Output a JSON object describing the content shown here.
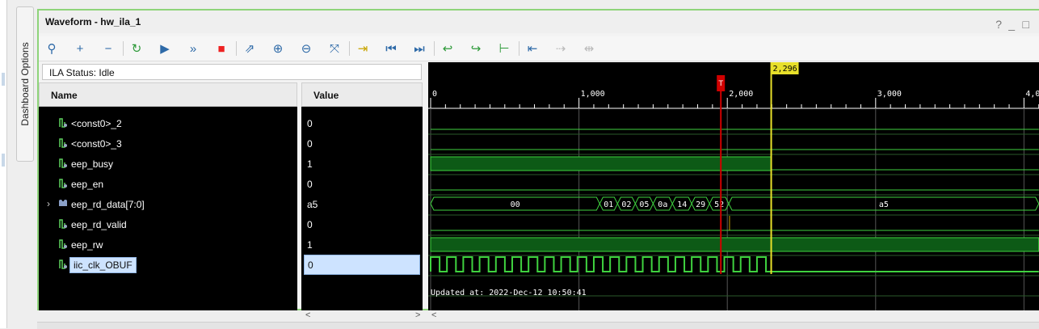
{
  "sidebar": {
    "dashboard_tab_label": "Dashboard Options"
  },
  "window": {
    "title": "Waveform - hw_ila_1",
    "help_label": "?",
    "minimize_label": "_",
    "restore_label": "□",
    "close_label": "X"
  },
  "toolbar": {
    "buttons": [
      {
        "name": "zoom-search-button",
        "icon": "magnifier-icon",
        "glyph": "⚲"
      },
      {
        "name": "add-probe-button",
        "icon": "plus-icon",
        "glyph": "+"
      },
      {
        "name": "remove-probe-button",
        "icon": "minus-icon",
        "glyph": "−"
      },
      {
        "name": "run-trigger-immediate-button",
        "icon": "refresh-icon",
        "glyph": "↻"
      },
      {
        "name": "run-trigger-button",
        "icon": "play-icon",
        "glyph": "▶"
      },
      {
        "name": "run-immediate-button",
        "icon": "double-chevron-icon",
        "glyph": "»"
      },
      {
        "name": "stop-trigger-button",
        "icon": "stop-icon",
        "glyph": "■"
      },
      {
        "name": "export-button",
        "icon": "export-icon",
        "glyph": "⇗"
      },
      {
        "name": "zoom-in-button",
        "icon": "zoom-in-icon",
        "glyph": "⊕"
      },
      {
        "name": "zoom-out-button",
        "icon": "zoom-out-icon",
        "glyph": "⊖"
      },
      {
        "name": "zoom-fit-button",
        "icon": "zoom-fit-icon",
        "glyph": "⤧"
      },
      {
        "name": "go-to-cursor-button",
        "icon": "go-to-cursor-icon",
        "glyph": "⇥"
      },
      {
        "name": "go-to-time-zero-button",
        "icon": "go-to-start-icon",
        "glyph": "⏮"
      },
      {
        "name": "go-to-last-time-button",
        "icon": "go-to-end-icon",
        "glyph": "⏭"
      },
      {
        "name": "previous-transition-button",
        "icon": "previous-transition-icon",
        "glyph": "↩"
      },
      {
        "name": "next-transition-button",
        "icon": "next-transition-icon",
        "glyph": "↪"
      },
      {
        "name": "add-marker-button",
        "icon": "add-marker-icon",
        "glyph": "⊢"
      },
      {
        "name": "previous-marker-button",
        "icon": "previous-marker-icon",
        "glyph": "⇤"
      },
      {
        "name": "next-marker-button",
        "icon": "next-marker-icon",
        "glyph": "⇢"
      },
      {
        "name": "swap-cursors-button",
        "icon": "swap-cursors-icon",
        "glyph": "⇹"
      }
    ]
  },
  "status": {
    "text": "ILA Status: Idle"
  },
  "columns": {
    "name": "Name",
    "value": "Value"
  },
  "signals": [
    {
      "name": "<const0>_2",
      "value": "0",
      "type": "bit",
      "expandable": false
    },
    {
      "name": "<const0>_3",
      "value": "0",
      "type": "bit",
      "expandable": false
    },
    {
      "name": "eep_busy",
      "value": "1",
      "type": "bit",
      "expandable": false
    },
    {
      "name": "eep_en",
      "value": "0",
      "type": "bit",
      "expandable": false
    },
    {
      "name": "eep_rd_data[7:0]",
      "value": "a5",
      "type": "bus",
      "expandable": true
    },
    {
      "name": "eep_rd_valid",
      "value": "0",
      "type": "bit",
      "expandable": false
    },
    {
      "name": "eep_rw",
      "value": "1",
      "type": "bit",
      "expandable": false
    },
    {
      "name": "iic_clk_OBUF",
      "value": "0",
      "type": "bit",
      "expandable": false,
      "selected": true
    }
  ],
  "waveform": {
    "time_ticks": [
      "0",
      "1,000",
      "2,000",
      "3,000",
      "4,0"
    ],
    "time_max": 4000,
    "trigger_marker_label": "T",
    "trigger_time": 2000,
    "cursor_label": "2,296",
    "cursor_time": 2296,
    "bus_values": [
      "00",
      "01",
      "02",
      "05",
      "0a",
      "14",
      "29",
      "52",
      "a5"
    ],
    "updated_text": "Updated at: 2022-Dec-12 10:50:41"
  },
  "colors": {
    "waveform_green": "#3fd23f",
    "busy_fill": "#0d5a16",
    "trigger_red": "#d00000",
    "cursor_yellow": "#e8e02a",
    "frame_green": "#8ed47a"
  },
  "scroll": {
    "left_arrow": "<",
    "right_arrow": ">"
  }
}
